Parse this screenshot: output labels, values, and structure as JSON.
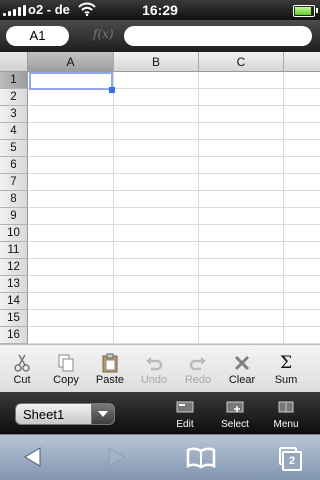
{
  "status_bar": {
    "carrier": "o2 - de",
    "time": "16:29"
  },
  "formula_bar": {
    "cell_ref": "A1",
    "fx_label": "f(x)",
    "formula_value": ""
  },
  "sheet": {
    "columns": [
      "A",
      "B",
      "C"
    ],
    "rows": [
      "1",
      "2",
      "3",
      "4",
      "5",
      "6",
      "7",
      "8",
      "9",
      "10",
      "11",
      "12",
      "13",
      "14",
      "15",
      "16"
    ],
    "selected_cell": "A1"
  },
  "toolbar": {
    "items": [
      {
        "label": "Cut",
        "icon": "scissors-icon",
        "enabled": true
      },
      {
        "label": "Copy",
        "icon": "copy-icon",
        "enabled": true
      },
      {
        "label": "Paste",
        "icon": "paste-icon",
        "enabled": true
      },
      {
        "label": "Undo",
        "icon": "undo-icon",
        "enabled": false
      },
      {
        "label": "Redo",
        "icon": "redo-icon",
        "enabled": false
      },
      {
        "label": "Clear",
        "icon": "clear-x-icon",
        "enabled": true
      },
      {
        "label": "Sum",
        "icon": "sigma-icon",
        "enabled": true,
        "glyph": "Σ"
      }
    ]
  },
  "sheet_bar": {
    "selected_sheet": "Sheet1",
    "buttons": [
      {
        "label": "Edit",
        "icon": "edit-icon"
      },
      {
        "label": "Select",
        "icon": "select-icon"
      },
      {
        "label": "Menu",
        "icon": "menu-icon"
      }
    ]
  },
  "browser_bar": {
    "tab_count": "2"
  }
}
